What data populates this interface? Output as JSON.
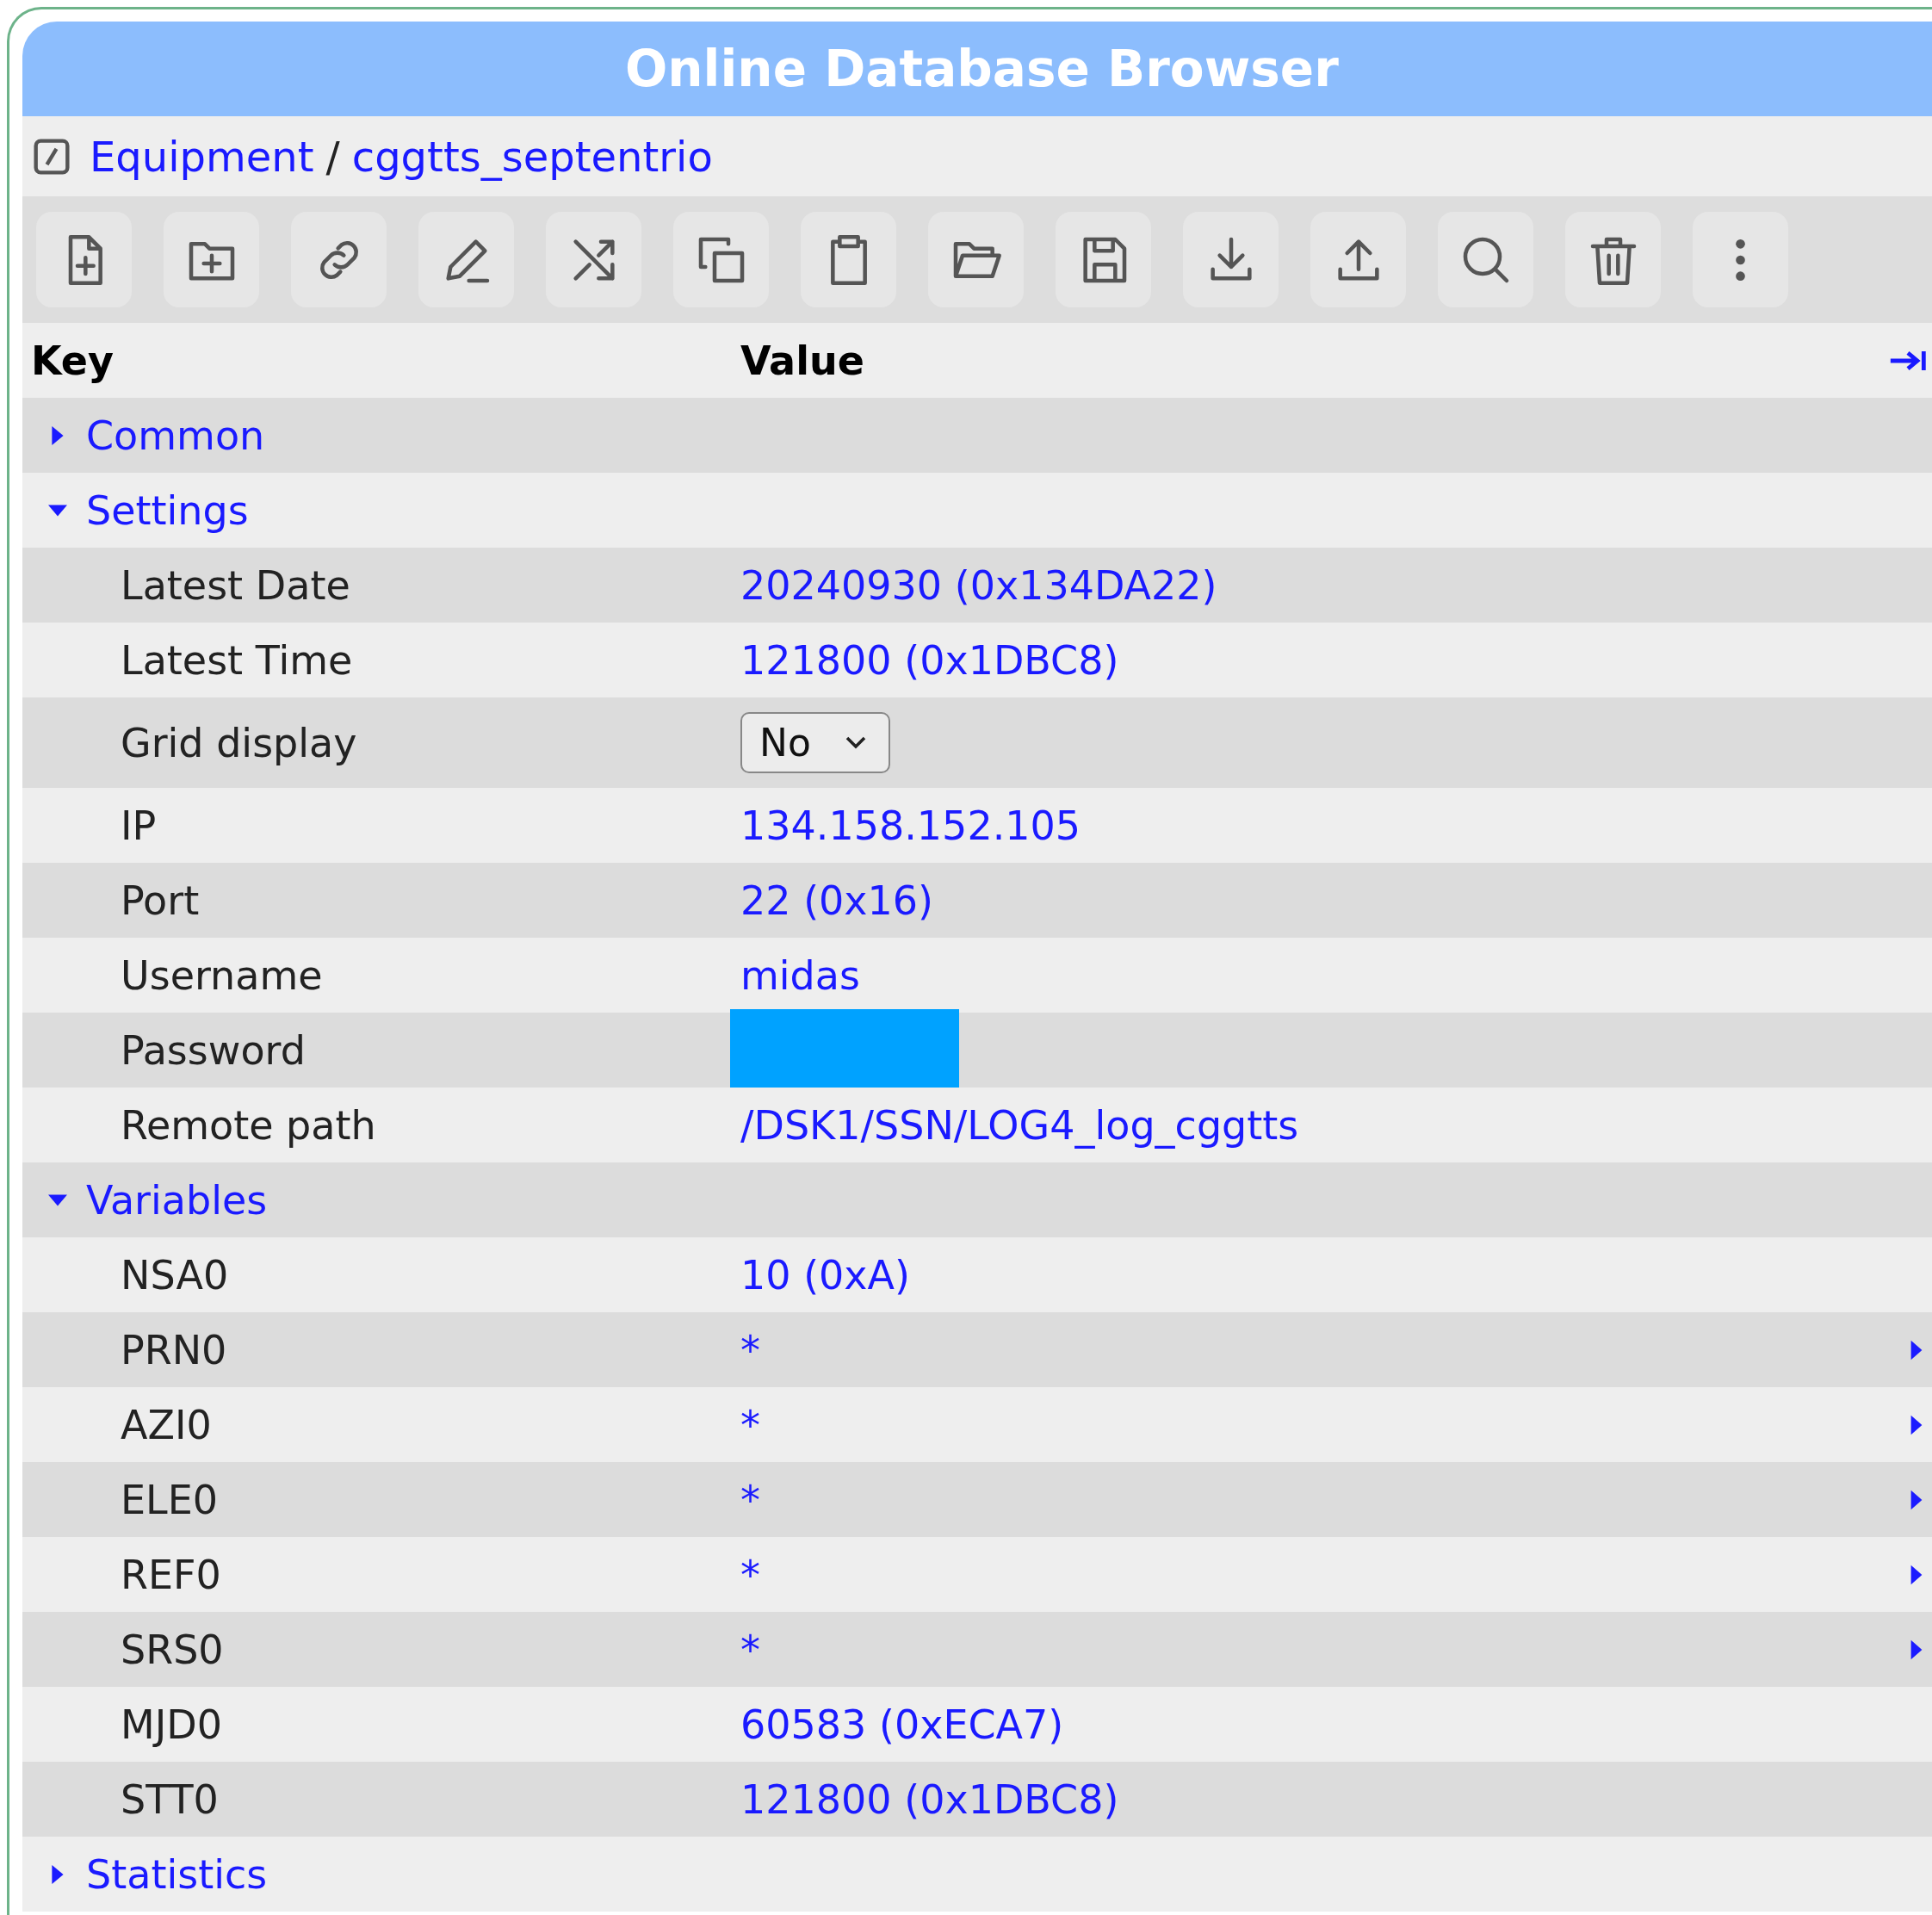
{
  "window": {
    "title": "Online Database Browser"
  },
  "breadcrumb": {
    "items": [
      {
        "text": "Equipment"
      },
      {
        "text": "cggtts_septentrio"
      }
    ],
    "separator": "/"
  },
  "toolbar": [
    {
      "kind": "new-file"
    },
    {
      "kind": "new-folder"
    },
    {
      "kind": "link"
    },
    {
      "kind": "rename"
    },
    {
      "kind": "shuffle"
    },
    {
      "kind": "copy"
    },
    {
      "kind": "paste"
    },
    {
      "kind": "open"
    },
    {
      "kind": "save"
    },
    {
      "kind": "download"
    },
    {
      "kind": "upload"
    },
    {
      "kind": "search"
    },
    {
      "kind": "delete"
    },
    {
      "kind": "more"
    }
  ],
  "table": {
    "columns": [
      "Key",
      "Value"
    ],
    "rows": [
      {
        "label": "Common",
        "expanded": false
      },
      {
        "label": "Settings",
        "expanded": true,
        "children": [
          {
            "key": "Latest Date",
            "kind": "text",
            "value": "20240930 (0x134DA22)"
          },
          {
            "key": "Latest Time",
            "kind": "text",
            "value": "121800 (0x1DBC8)"
          },
          {
            "key": "Grid display",
            "kind": "select",
            "value": "No"
          },
          {
            "key": "IP",
            "kind": "text",
            "value": "134.158.152.105"
          },
          {
            "key": "Port",
            "kind": "text",
            "value": "22 (0x16)"
          },
          {
            "key": "Username",
            "kind": "text",
            "value": "midas"
          },
          {
            "key": "Password",
            "kind": "redacted"
          },
          {
            "key": "Remote path",
            "kind": "text",
            "value": "/DSK1/SSN/LOG4_log_cggtts"
          }
        ]
      },
      {
        "label": "Variables",
        "expanded": true,
        "children": [
          {
            "key": "NSA0",
            "kind": "text",
            "value": "10 (0xA)"
          },
          {
            "key": "PRN0",
            "kind": "array",
            "value": "*"
          },
          {
            "key": "AZI0",
            "kind": "array",
            "value": "*"
          },
          {
            "key": "ELE0",
            "kind": "array",
            "value": "*"
          },
          {
            "key": "REF0",
            "kind": "array",
            "value": "*"
          },
          {
            "key": "SRS0",
            "kind": "array",
            "value": "*"
          },
          {
            "key": "MJD0",
            "kind": "text",
            "value": "60583 (0xECA7)"
          },
          {
            "key": "STT0",
            "kind": "text",
            "value": "121800 (0x1DBC8)"
          }
        ]
      },
      {
        "label": "Statistics",
        "expanded": false
      }
    ]
  }
}
